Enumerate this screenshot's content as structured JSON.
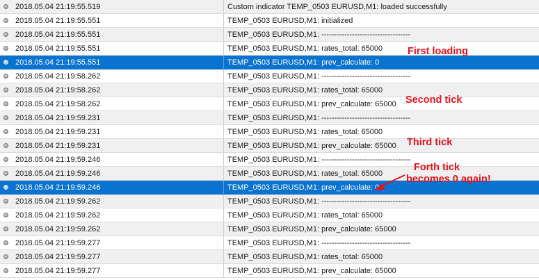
{
  "log_rows": [
    {
      "time": "2018.05.04 21:19:55.519",
      "message": "Custom indicator TEMP_0503 EURUSD,M1: loaded successfully"
    },
    {
      "time": "2018.05.04 21:19:55.551",
      "message": "TEMP_0503 EURUSD,M1: initialized"
    },
    {
      "time": "2018.05.04 21:19:55.551",
      "message": "TEMP_0503 EURUSD,M1: -----------------------------------"
    },
    {
      "time": "2018.05.04 21:19:55.551",
      "message": "TEMP_0503 EURUSD,M1: rates_total: 65000"
    },
    {
      "time": "2018.05.04 21:19:55.551",
      "message": "TEMP_0503 EURUSD,M1: prev_calculate: 0",
      "selected": true
    },
    {
      "time": "2018.05.04 21:19:58.262",
      "message": "TEMP_0503 EURUSD,M1: -----------------------------------"
    },
    {
      "time": "2018.05.04 21:19:58.262",
      "message": "TEMP_0503 EURUSD,M1: rates_total: 65000"
    },
    {
      "time": "2018.05.04 21:19:58.262",
      "message": "TEMP_0503 EURUSD,M1: prev_calculate: 65000"
    },
    {
      "time": "2018.05.04 21:19:59.231",
      "message": "TEMP_0503 EURUSD,M1: -----------------------------------"
    },
    {
      "time": "2018.05.04 21:19:59.231",
      "message": "TEMP_0503 EURUSD,M1: rates_total: 65000"
    },
    {
      "time": "2018.05.04 21:19:59.231",
      "message": "TEMP_0503 EURUSD,M1: prev_calculate: 65000"
    },
    {
      "time": "2018.05.04 21:19:59.246",
      "message": "TEMP_0503 EURUSD,M1: -----------------------------------"
    },
    {
      "time": "2018.05.04 21:19:59.246",
      "message": "TEMP_0503 EURUSD,M1: rates_total: 65000"
    },
    {
      "time": "2018.05.04 21:19:59.246",
      "message": "TEMP_0503 EURUSD,M1: prev_calculate: 0",
      "selected": true
    },
    {
      "time": "2018.05.04 21:19:59.262",
      "message": "TEMP_0503 EURUSD,M1: -----------------------------------"
    },
    {
      "time": "2018.05.04 21:19:59.262",
      "message": "TEMP_0503 EURUSD,M1: rates_total: 65000"
    },
    {
      "time": "2018.05.04 21:19:59.262",
      "message": "TEMP_0503 EURUSD,M1: prev_calculate: 65000"
    },
    {
      "time": "2018.05.04 21:19:59.277",
      "message": "TEMP_0503 EURUSD,M1: -----------------------------------"
    },
    {
      "time": "2018.05.04 21:19:59.277",
      "message": "TEMP_0503 EURUSD,M1: rates_total: 65000"
    },
    {
      "time": "2018.05.04 21:19:59.277",
      "message": "TEMP_0503 EURUSD,M1: prev_calculate: 65000"
    }
  ],
  "annotations": {
    "first_loading": "First loading",
    "second_tick": "Second tick",
    "third_tick": "Third tick",
    "forth_tick_line1": "Forth tick",
    "forth_tick_line2": "becomes 0 again!"
  },
  "colors": {
    "selected_row": "#0a73cf",
    "annotation": "#e8111a"
  },
  "icons": {
    "row_status": "circle-dot-icon",
    "annotation_pointer": "arrow-icon"
  }
}
